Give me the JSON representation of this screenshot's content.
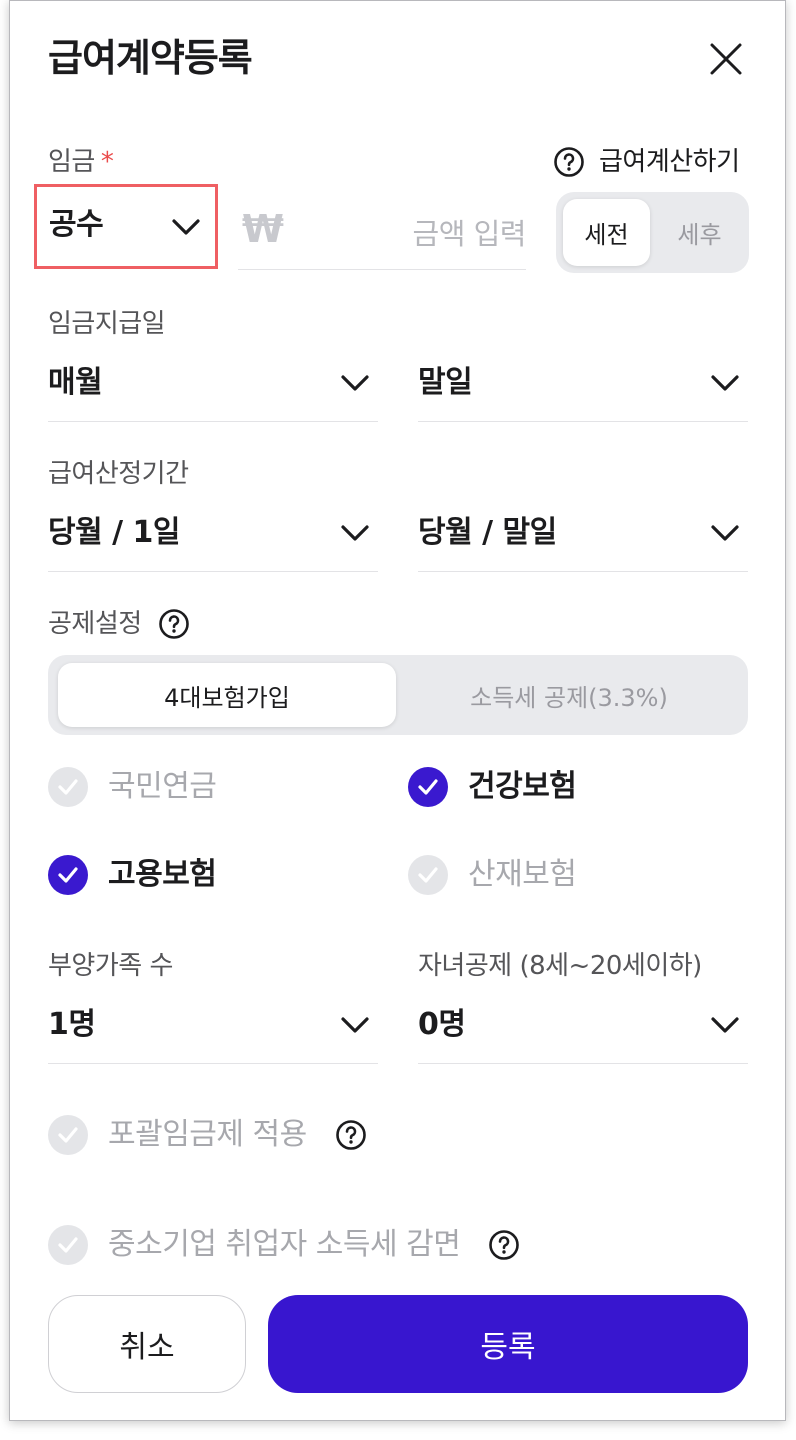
{
  "header": {
    "title": "급여계약등록"
  },
  "wage": {
    "label": "임금",
    "required_mark": "*",
    "calc_link": "급여계산하기",
    "type_value": "공수",
    "currency_symbol": "₩",
    "amount_placeholder": "금액 입력",
    "tax_toggle": {
      "options": [
        "세전",
        "세후"
      ],
      "selected": "세전"
    }
  },
  "pay_day": {
    "label": "임금지급일",
    "cycle": "매월",
    "day": "말일"
  },
  "calc_period": {
    "label": "급여산정기간",
    "start": "당월 / 1일",
    "end": "당월 / 말일"
  },
  "deduction": {
    "label": "공제설정",
    "options": [
      "4대보험가입",
      "소득세 공제(3.3%)"
    ],
    "selected": "4대보험가입"
  },
  "insurance": [
    {
      "label": "국민연금",
      "checked": false
    },
    {
      "label": "건강보험",
      "checked": true
    },
    {
      "label": "고용보험",
      "checked": true
    },
    {
      "label": "산재보험",
      "checked": false
    }
  ],
  "dependents": {
    "label": "부양가족 수",
    "value": "1명"
  },
  "children": {
    "label": "자녀공제 (8세~20세이하)",
    "value": "0명"
  },
  "extras": {
    "inclusive_wage": {
      "label": "포괄임금제 적용",
      "checked": false
    },
    "sme_tax_relief": {
      "label": "중소기업 취업자 소득세 감면",
      "checked": false
    }
  },
  "footer": {
    "cancel_label": "취소",
    "submit_label": "등록"
  },
  "colors": {
    "primary": "#3816cf",
    "required": "#ea4b4b",
    "highlight": "#ef5f63"
  }
}
